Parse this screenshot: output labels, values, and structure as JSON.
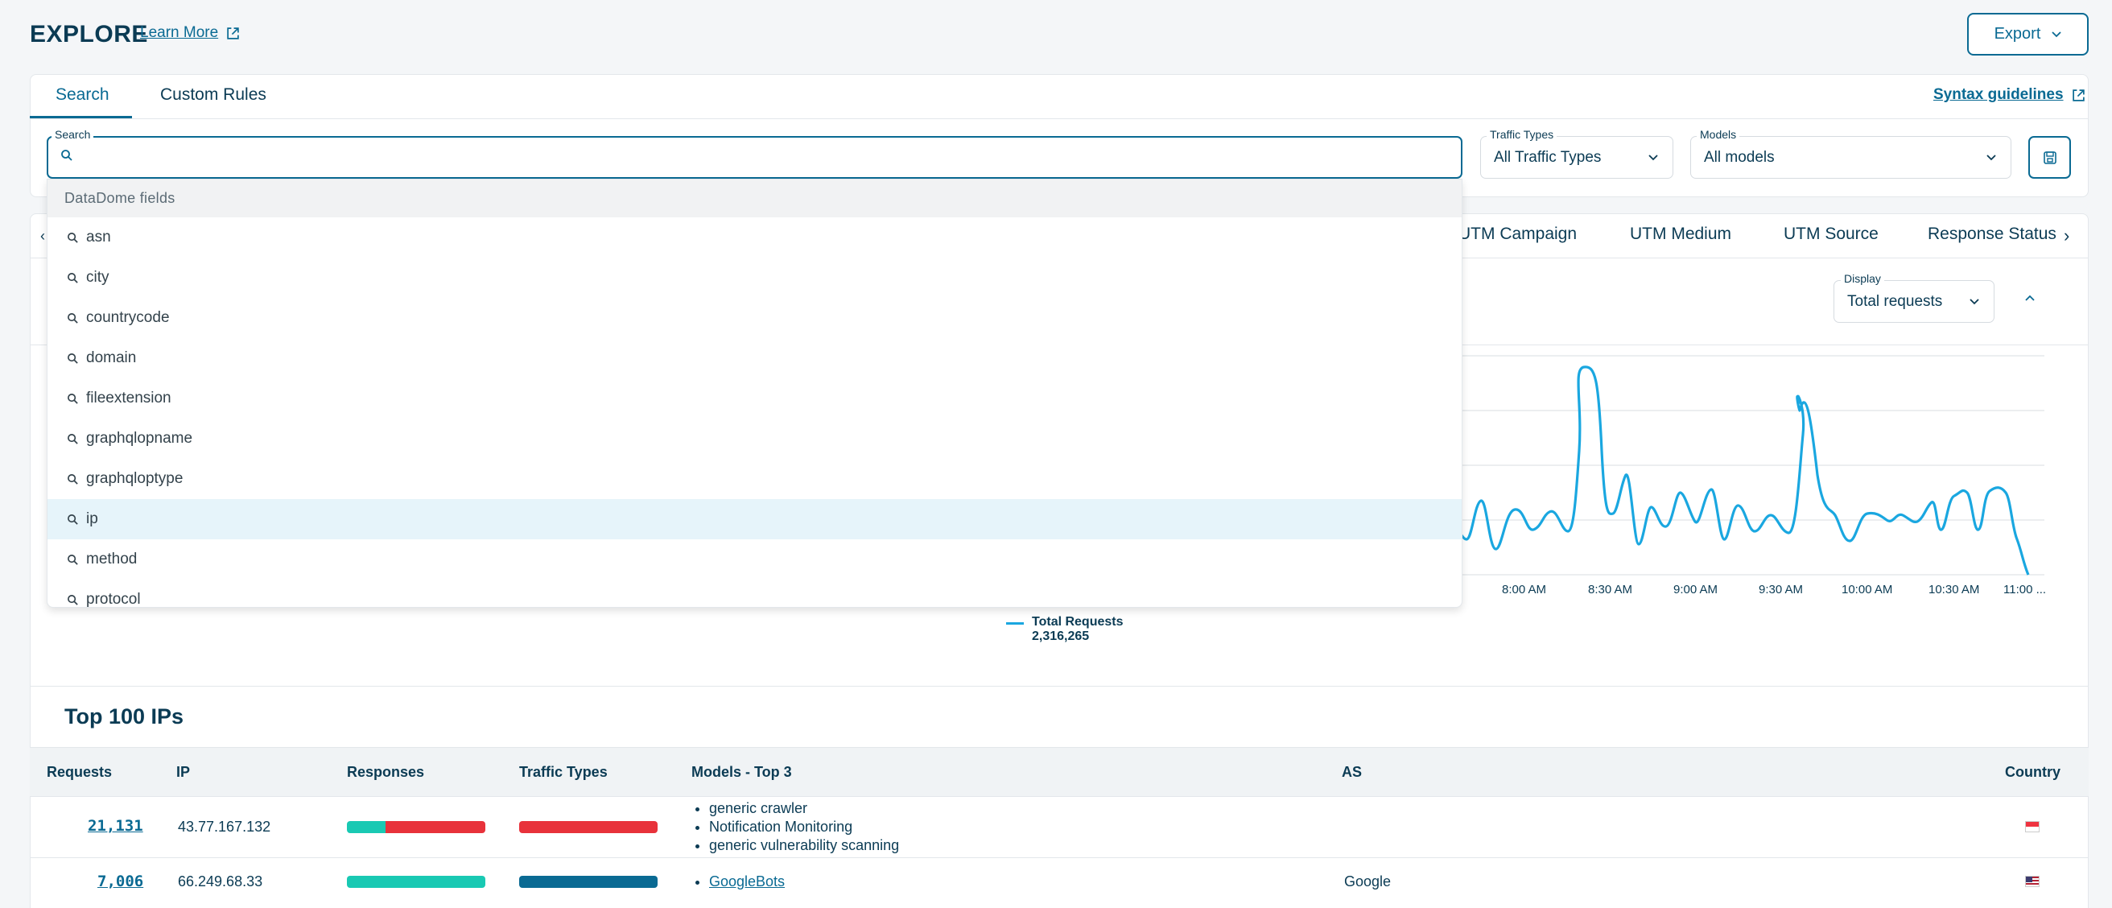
{
  "header": {
    "title": "EXPLORE",
    "learn_more": "Learn More",
    "export_label": "Export"
  },
  "tabs": [
    {
      "label": "Search",
      "active": true
    },
    {
      "label": "Custom Rules",
      "active": false
    }
  ],
  "syntax_link": "Syntax guidelines",
  "filters": {
    "search_label": "Search",
    "search_value": "",
    "traffic_types_label": "Traffic Types",
    "traffic_types_value": "All Traffic Types",
    "models_label": "Models",
    "models_value": "All models"
  },
  "dropdown": {
    "header": "DataDome fields",
    "items": [
      "asn",
      "city",
      "countrycode",
      "domain",
      "fileextension",
      "graphqlopname",
      "graphqloptype",
      "ip",
      "method",
      "protocol"
    ],
    "highlighted": "ip"
  },
  "dimension_tabs": [
    "UTM Campaign",
    "UTM Medium",
    "UTM Source",
    "Response Status"
  ],
  "display": {
    "label": "Display",
    "value": "Total requests"
  },
  "chart_data": {
    "type": "line",
    "x_ticks": [
      "8:00 AM",
      "8:30 AM",
      "9:00 AM",
      "9:30 AM",
      "10:00 AM",
      "10:30 AM",
      "11:00 ..."
    ],
    "series": [
      {
        "name": "Total Requests",
        "total": "2,316,265",
        "color": "#1aa7e0"
      }
    ],
    "grid": true
  },
  "table": {
    "title": "Top 100 IPs",
    "columns": [
      "Requests",
      "IP",
      "Responses",
      "Traffic Types",
      "Models - Top 3",
      "AS",
      "Country"
    ],
    "rows": [
      {
        "requests": "21,131",
        "ip": "43.77.167.132",
        "responses_green_fraction": 0.28,
        "traffic_color": "#e8323b",
        "models": [
          "generic crawler",
          "Notification Monitoring",
          "generic vulnerability scanning"
        ],
        "as": "",
        "country": "SG"
      },
      {
        "requests": "7,006",
        "ip": "66.249.68.33",
        "responses_green_fraction": 1.0,
        "traffic_color": "#0a6a93",
        "models": [
          "GoogleBots"
        ],
        "as": "Google",
        "country": "US"
      }
    ]
  },
  "colors": {
    "accent": "#0a6a93",
    "line": "#1aa7e0",
    "green": "#19c9b3",
    "red": "#e8323b"
  }
}
